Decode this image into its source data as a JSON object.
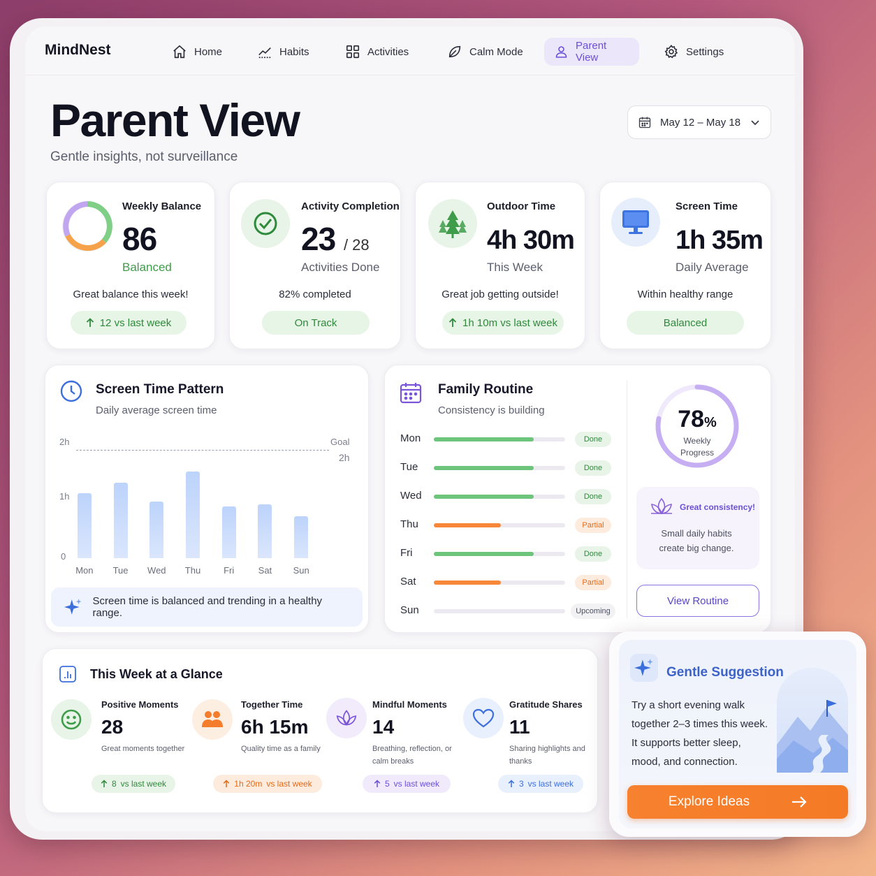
{
  "app": {
    "name": "MindNest"
  },
  "nav": [
    {
      "label": "Home",
      "icon": "home-icon"
    },
    {
      "label": "Habits",
      "icon": "trend-chart-icon"
    },
    {
      "label": "Activities",
      "icon": "grid-icon"
    },
    {
      "label": "Calm Mode",
      "icon": "leaf-icon"
    },
    {
      "label": "Parent View",
      "icon": "user-icon",
      "active": true
    },
    {
      "label": "Settings",
      "icon": "gear-icon"
    }
  ],
  "header": {
    "title": "Parent View",
    "subtitle": "Gentle insights, not surveillance",
    "date_range": "May 12 – May 18"
  },
  "stats": [
    {
      "label": "Weekly Balance",
      "value": "86",
      "sub": "Balanced",
      "note": "Great balance this week!",
      "pill": "12 vs last week"
    },
    {
      "label": "Activity Completion",
      "value": "23",
      "value_suffix": "/ 28",
      "sub": "Activities Done",
      "note": "82% completed",
      "pill": "On Track"
    },
    {
      "label": "Outdoor Time",
      "value": "4h 30m",
      "sub": "This Week",
      "note": "Great job getting outside!",
      "pill": "1h 10m vs last week"
    },
    {
      "label": "Screen Time",
      "value": "1h 35m",
      "sub": "Daily Average",
      "note": "Within healthy range",
      "pill": "Balanced"
    }
  ],
  "screen_pattern": {
    "title": "Screen Time Pattern",
    "subtitle": "Daily average screen time",
    "goal_label": "Goal",
    "goal_value": "2h",
    "insight": "Screen time is balanced and trending in a healthy range."
  },
  "chart_data": {
    "type": "bar",
    "categories": [
      "Mon",
      "Tue",
      "Wed",
      "Thu",
      "Fri",
      "Sat",
      "Sun"
    ],
    "values": [
      1.2,
      1.4,
      1.04,
      1.6,
      0.96,
      1.0,
      0.78
    ],
    "y_ticks": [
      "0",
      "1h",
      "2h"
    ],
    "ylim": [
      0,
      2
    ],
    "goal": 2,
    "grid": false
  },
  "routine": {
    "title": "Family Routine",
    "subtitle": "Consistency is building",
    "days": [
      {
        "day": "Mon",
        "progress": 0.76,
        "status": "Done"
      },
      {
        "day": "Tue",
        "progress": 0.76,
        "status": "Done"
      },
      {
        "day": "Wed",
        "progress": 0.76,
        "status": "Done"
      },
      {
        "day": "Thu",
        "progress": 0.51,
        "status": "Partial"
      },
      {
        "day": "Fri",
        "progress": 0.76,
        "status": "Done"
      },
      {
        "day": "Sat",
        "progress": 0.51,
        "status": "Partial"
      },
      {
        "day": "Sun",
        "progress": 0,
        "status": "Upcoming"
      }
    ],
    "weekly_progress": "78",
    "weekly_progress_unit": "%",
    "weekly_label": "Weekly Progress",
    "weekly_fraction": 0.78,
    "consistency_title": "Great consistency!",
    "consistency_text": "Small daily habits create big change.",
    "button": "View Routine"
  },
  "glance": {
    "title": "This Week at a Glance",
    "items": [
      {
        "title": "Positive Moments",
        "value": "28",
        "sub": "Great moments together",
        "pill_num": "8",
        "pill_txt": "vs last week"
      },
      {
        "title": "Together Time",
        "value": "6h 15m",
        "sub": "Quality time as a family",
        "pill_num": "1h 20m",
        "pill_txt": "vs last week"
      },
      {
        "title": "Mindful Moments",
        "value": "14",
        "sub": "Breathing, reflection, or calm breaks",
        "pill_num": "5",
        "pill_txt": "vs last week"
      },
      {
        "title": "Gratitude Shares",
        "value": "11",
        "sub": "Sharing highlights and thanks",
        "pill_num": "3",
        "pill_txt": "vs last week"
      }
    ]
  },
  "suggestion": {
    "title": "Gentle Suggestion",
    "text": "Try a short evening walk together 2–3 times this week. It supports better sleep, mood, and connection.",
    "button": "Explore Ideas"
  },
  "colors": {
    "accent": "#6b4fd6",
    "green": "#6cc57a",
    "orange": "#f7883a",
    "blue": "#3d63c8"
  }
}
